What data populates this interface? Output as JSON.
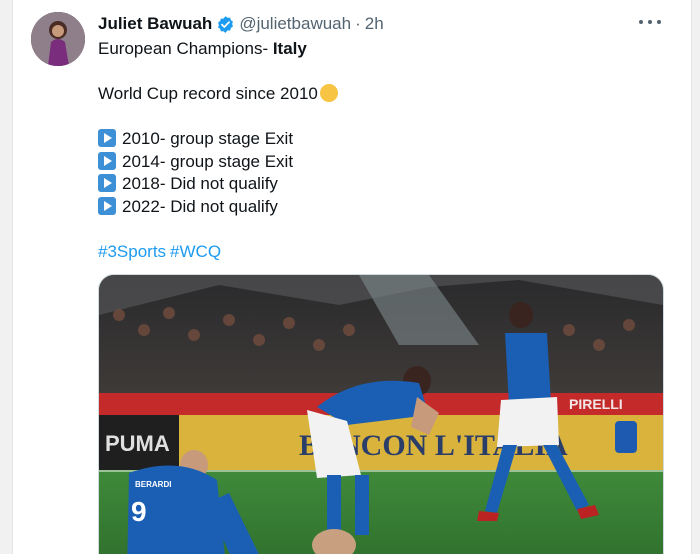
{
  "tweet": {
    "author_name": "Juliet Bawuah",
    "author_handle": "@juliet­bawuah",
    "separator": "·",
    "timestamp": "2h",
    "lines": [
      {
        "prefix": "European Champions- ",
        "bold": "Italy"
      },
      {
        "text": "World Cup record since 2010"
      },
      {
        "list": [
          "2010- group stage Exit",
          "2014- group stage Exit",
          "2018- Did not qualify",
          "2022- Did not qualify"
        ]
      }
    ],
    "hashtags": [
      "#3Sports",
      "#WCQ"
    ]
  },
  "media": {
    "banner_text": "BENCON L'ITALIA",
    "jersey_number": "9",
    "jersey_name": "BERARDI"
  },
  "colors": {
    "link": "#1d9bf0",
    "verified": "#1d9bf0",
    "italy_blue": "#1b5fb4"
  },
  "icons": [
    "verified-icon",
    "more-icon",
    "play-button-icon",
    "face-with-rolling-eyes-icon"
  ]
}
